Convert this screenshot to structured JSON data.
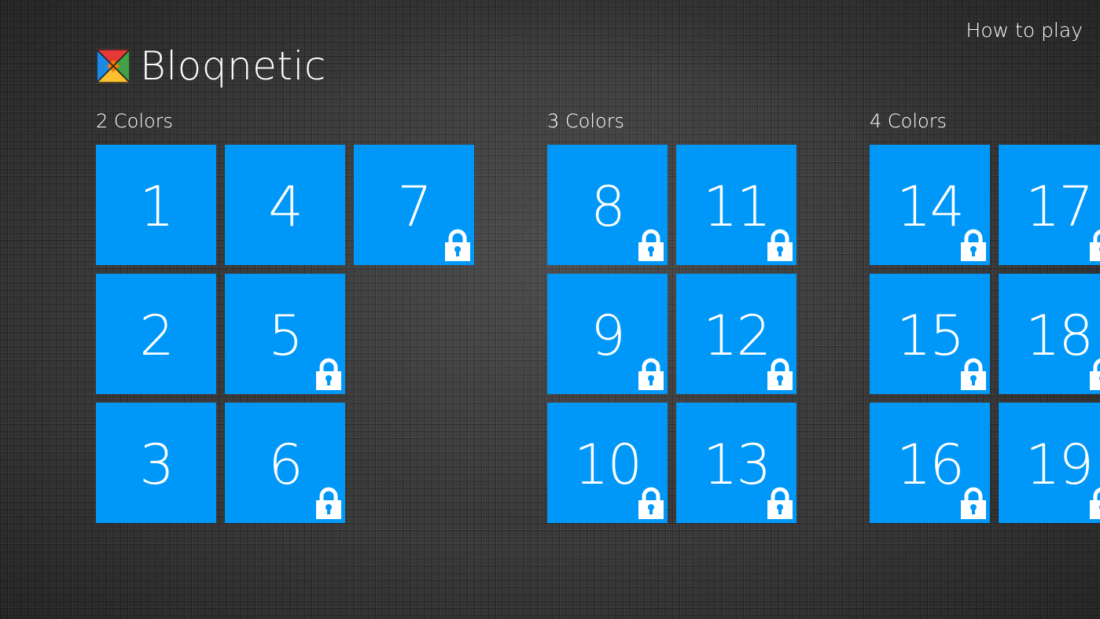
{
  "header": {
    "app_title": "Bloqnetic",
    "logo_icon": "bloqnetic-logo-icon",
    "how_to_play": "How to play"
  },
  "colors": {
    "tile": "#0098f8",
    "background": "#3a3a3a",
    "text": "#ffffff"
  },
  "groups": [
    {
      "label": "2 Colors",
      "levels": [
        {
          "number": "1",
          "locked": false
        },
        {
          "number": "2",
          "locked": false
        },
        {
          "number": "3",
          "locked": false
        },
        {
          "number": "4",
          "locked": false
        },
        {
          "number": "5",
          "locked": true
        },
        {
          "number": "6",
          "locked": true
        },
        {
          "number": "7",
          "locked": true
        }
      ]
    },
    {
      "label": "3 Colors",
      "levels": [
        {
          "number": "8",
          "locked": true
        },
        {
          "number": "9",
          "locked": true
        },
        {
          "number": "10",
          "locked": true
        },
        {
          "number": "11",
          "locked": true
        },
        {
          "number": "12",
          "locked": true
        },
        {
          "number": "13",
          "locked": true
        }
      ]
    },
    {
      "label": "4 Colors",
      "levels": [
        {
          "number": "14",
          "locked": true
        },
        {
          "number": "15",
          "locked": true
        },
        {
          "number": "16",
          "locked": true
        },
        {
          "number": "17",
          "locked": true
        },
        {
          "number": "18",
          "locked": true
        },
        {
          "number": "19",
          "locked": true
        }
      ]
    }
  ]
}
